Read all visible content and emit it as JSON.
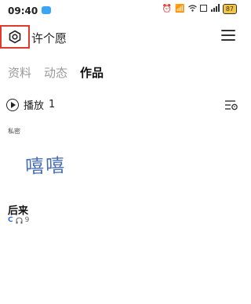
{
  "status_bar": {
    "time": "09:40",
    "battery": "87",
    "badge_color": "#3ba4f3",
    "icons": [
      "alarm-icon",
      "signal-icon",
      "wifi-icon",
      "hd-icon",
      "signal-bars-icon",
      "battery-icon"
    ]
  },
  "header": {
    "settings_icon": "settings-icon",
    "profile_name": "许个愿",
    "menu_icon": "hamburger-menu-icon",
    "highlight_color": "#e03a2f"
  },
  "tabs": [
    {
      "label": "资料",
      "active": false
    },
    {
      "label": "动态",
      "active": false
    },
    {
      "label": "作品",
      "active": true
    }
  ],
  "play_all": {
    "label": "播放",
    "count": "1"
  },
  "private_label": "私密",
  "handwriting": "嘻嘻",
  "song": {
    "title": "后来",
    "badge": "C",
    "listen_count": "9"
  }
}
